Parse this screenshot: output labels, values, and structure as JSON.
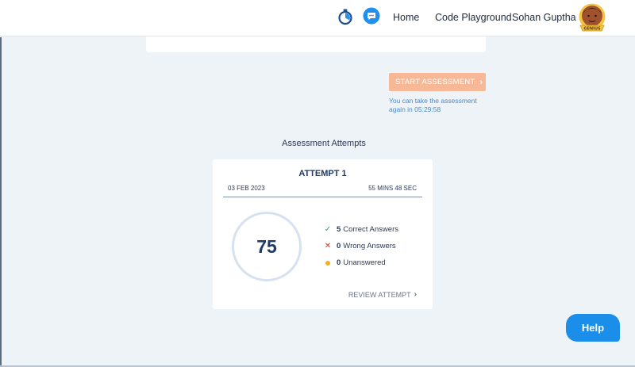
{
  "header": {
    "nav": {
      "home": "Home",
      "code_playground": "Code Playground"
    },
    "user": {
      "name": "Sohan Guptha",
      "badge": "GENIUS"
    },
    "icons": [
      "timer-icon",
      "chat-icon"
    ]
  },
  "assessment": {
    "start_button": "START ASSESSMENT",
    "retake_note": "You can take the assessment again in 05:29:58"
  },
  "attempts": {
    "title": "Assessment Attempts",
    "items": [
      {
        "heading": "ATTEMPT 1",
        "date": "03 FEB 2023",
        "duration": "55 MINS 48 SEC",
        "score": "75",
        "correct": {
          "count": "5",
          "label": "Correct Answers"
        },
        "wrong": {
          "count": "0",
          "label": "Wrong Answers"
        },
        "unanswered": {
          "count": "0",
          "label": "Unanswered"
        },
        "review": "REVIEW ATTEMPT"
      }
    ]
  },
  "help": {
    "label": "Help"
  },
  "colors": {
    "accent": "#1a8ee8",
    "start_button": "#f7b898",
    "note": "#4a88c8"
  }
}
